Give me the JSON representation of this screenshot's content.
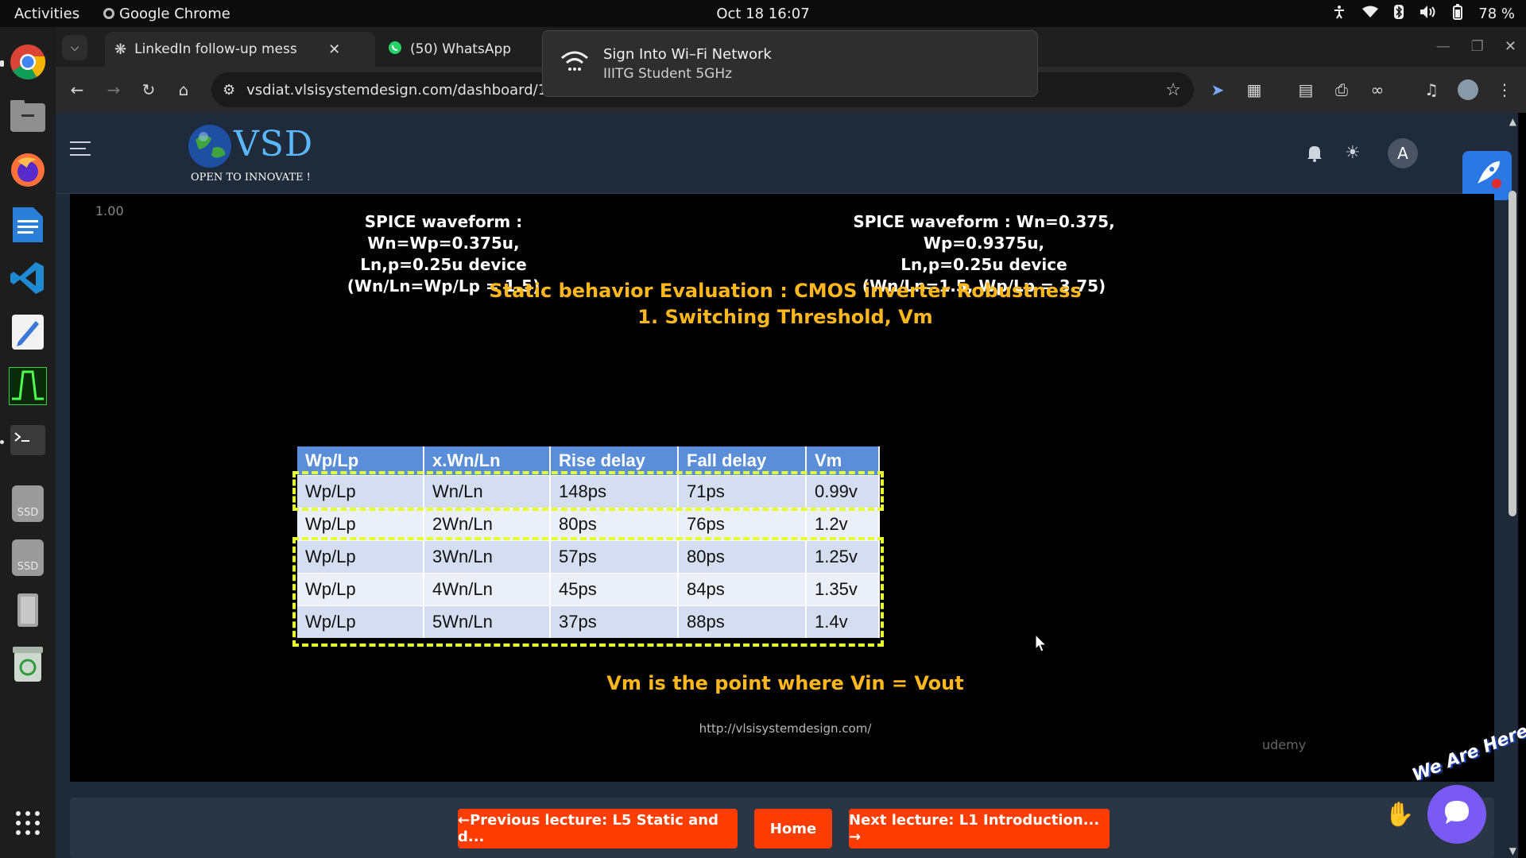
{
  "system": {
    "activities": "Activities",
    "app_name": "Google Chrome",
    "clock": "Oct 18  16:07",
    "battery": "78 %"
  },
  "dock": {
    "ssd_label_1": "SSD",
    "ssd_label_2": "SSD"
  },
  "browser": {
    "tabs": [
      {
        "label": "LinkedIn follow-up mess"
      },
      {
        "label": "(50) WhatsApp"
      }
    ],
    "url": "vsdiat.vlsisystemdesign.com/dashboard/14"
  },
  "notification": {
    "title": "Sign Into Wi–Fi Network",
    "subtitle": "IIITG Student 5GHz"
  },
  "site": {
    "logo_text": "VSD",
    "tagline": "OPEN TO INNOVATE !",
    "avatar_letter": "A"
  },
  "video": {
    "speed": "1.00",
    "left_caption": [
      "SPICE waveform : Wn=Wp=0.375u,",
      "Ln,p=0.25u device",
      "(Wn/Ln=Wp/Lp = 1.5)"
    ],
    "right_caption": [
      "SPICE waveform : Wn=0.375, Wp=0.9375u,",
      "Ln,p=0.25u device",
      "(Wn/Ln=1.5, Wp/Lp = 3.75)"
    ],
    "title_line1": "Static behavior Evaluation : CMOS inverter Robustness",
    "title_line2": "1. Switching Threshold, Vm",
    "table": {
      "headers": [
        "Wp/Lp",
        "x.Wn/Ln",
        "Rise delay",
        "Fall delay",
        "Vm"
      ],
      "rows": [
        [
          "Wp/Lp",
          "Wn/Ln",
          "148ps",
          "71ps",
          "0.99v"
        ],
        [
          "Wp/Lp",
          "2Wn/Ln",
          "80ps",
          "76ps",
          "1.2v"
        ],
        [
          "Wp/Lp",
          "3Wn/Ln",
          "57ps",
          "80ps",
          "1.25v"
        ],
        [
          "Wp/Lp",
          "4Wn/Ln",
          "45ps",
          "84ps",
          "1.35v"
        ],
        [
          "Wp/Lp",
          "5Wn/Ln",
          "37ps",
          "88ps",
          "1.4v"
        ]
      ]
    },
    "footer_note": "Vm is the point where Vin = Vout",
    "url_watermark": "http://vlsisystemdesign.com/",
    "udemy_watermark": "udemy"
  },
  "navigation": {
    "prev": "←Previous lecture: L5 Static and d...",
    "home": "Home",
    "next": "Next lecture: L1 Introduction...  →"
  },
  "chat": {
    "badge_text": "We Are Here!"
  },
  "colors": {
    "accent_orange": "#ff3d00",
    "slide_title": "#ffb81c",
    "highlight_dashed": "#e6ff2e",
    "table_header": "#5a8ed8"
  }
}
